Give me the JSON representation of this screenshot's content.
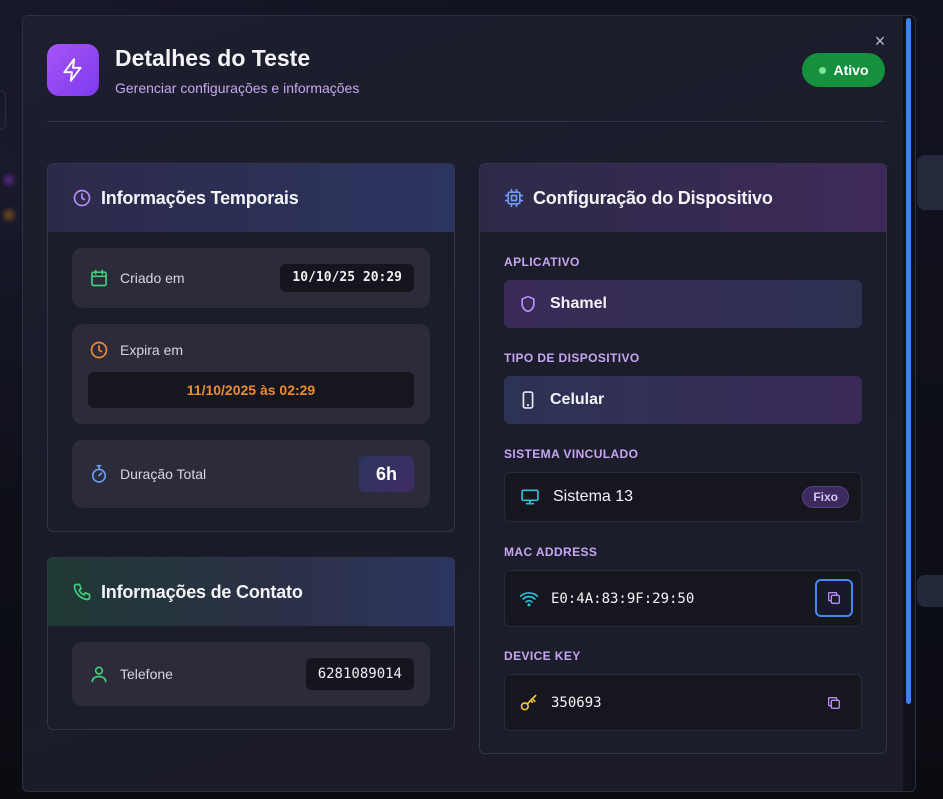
{
  "modal": {
    "title": "Detalhes do Teste",
    "subtitle": "Gerenciar configurações e informações",
    "status": "Ativo",
    "close_label": "×"
  },
  "temporal": {
    "heading": "Informações Temporais",
    "created_label": "Criado em",
    "created_value": "10/10/25 20:29",
    "expires_label": "Expira em",
    "expires_value": "11/10/2025 às 02:29",
    "duration_label": "Duração Total",
    "duration_value": "6h"
  },
  "contact": {
    "heading": "Informações de Contato",
    "phone_label": "Telefone",
    "phone_value": "6281089014"
  },
  "device": {
    "heading": "Configuração do Dispositivo",
    "app_label": "APLICATIVO",
    "app_value": "Shamel",
    "type_label": "TIPO DE DISPOSITIVO",
    "type_value": "Celular",
    "system_label": "SISTEMA VINCULADO",
    "system_value": "Sistema 13",
    "system_badge": "Fixo",
    "mac_label": "MAC ADDRESS",
    "mac_value": "E0:4A:83:9F:29:50",
    "key_label": "DEVICE KEY",
    "key_value": "350693"
  },
  "colors": {
    "accent_purple": "#a855f7",
    "status_green": "#15913d",
    "expire_orange": "#f08a2e",
    "scroll_blue": "#3b82f6"
  },
  "icons": [
    "zap-icon",
    "close-icon",
    "clock-icon",
    "calendar-icon",
    "timer-icon",
    "phone-icon",
    "user-icon",
    "cpu-icon",
    "shield-icon",
    "smartphone-icon",
    "monitor-icon",
    "wifi-icon",
    "key-icon",
    "copy-icon"
  ]
}
